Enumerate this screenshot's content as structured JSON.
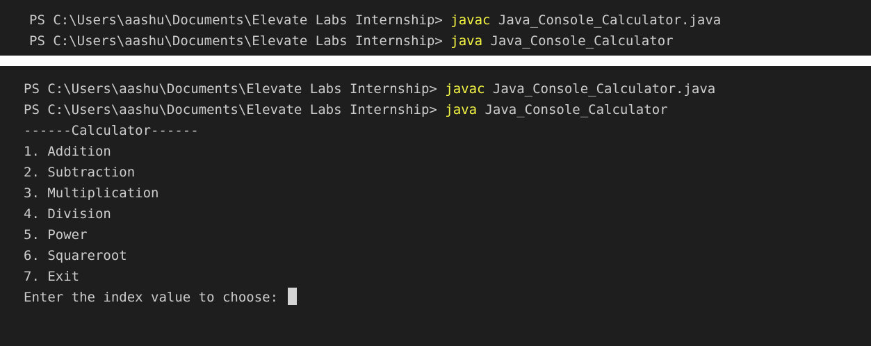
{
  "top_terminal": {
    "lines": [
      {
        "prompt": "PS C:\\Users\\aashu\\Documents\\Elevate Labs Internship> ",
        "command": "javac",
        "args": " Java_Console_Calculator.java"
      },
      {
        "prompt": "PS C:\\Users\\aashu\\Documents\\Elevate Labs Internship> ",
        "command": "java",
        "args": " Java_Console_Calculator"
      }
    ]
  },
  "bottom_terminal": {
    "commands": [
      {
        "prompt": "PS C:\\Users\\aashu\\Documents\\Elevate Labs Internship> ",
        "command": "javac",
        "args": " Java_Console_Calculator.java"
      },
      {
        "prompt": "PS C:\\Users\\aashu\\Documents\\Elevate Labs Internship> ",
        "command": "java",
        "args": " Java_Console_Calculator"
      }
    ],
    "header": "------Calculator------",
    "menu": [
      "1. Addition",
      "2. Subtraction",
      "3. Multiplication",
      "4. Division",
      "5. Power",
      "6. Squareroot",
      "7. Exit"
    ],
    "input_prompt": "Enter the index value to choose: "
  },
  "colors": {
    "background": "#1e1e1e",
    "text": "#cccccc",
    "command": "#f5f543",
    "cursor": "#d4d4d4"
  }
}
